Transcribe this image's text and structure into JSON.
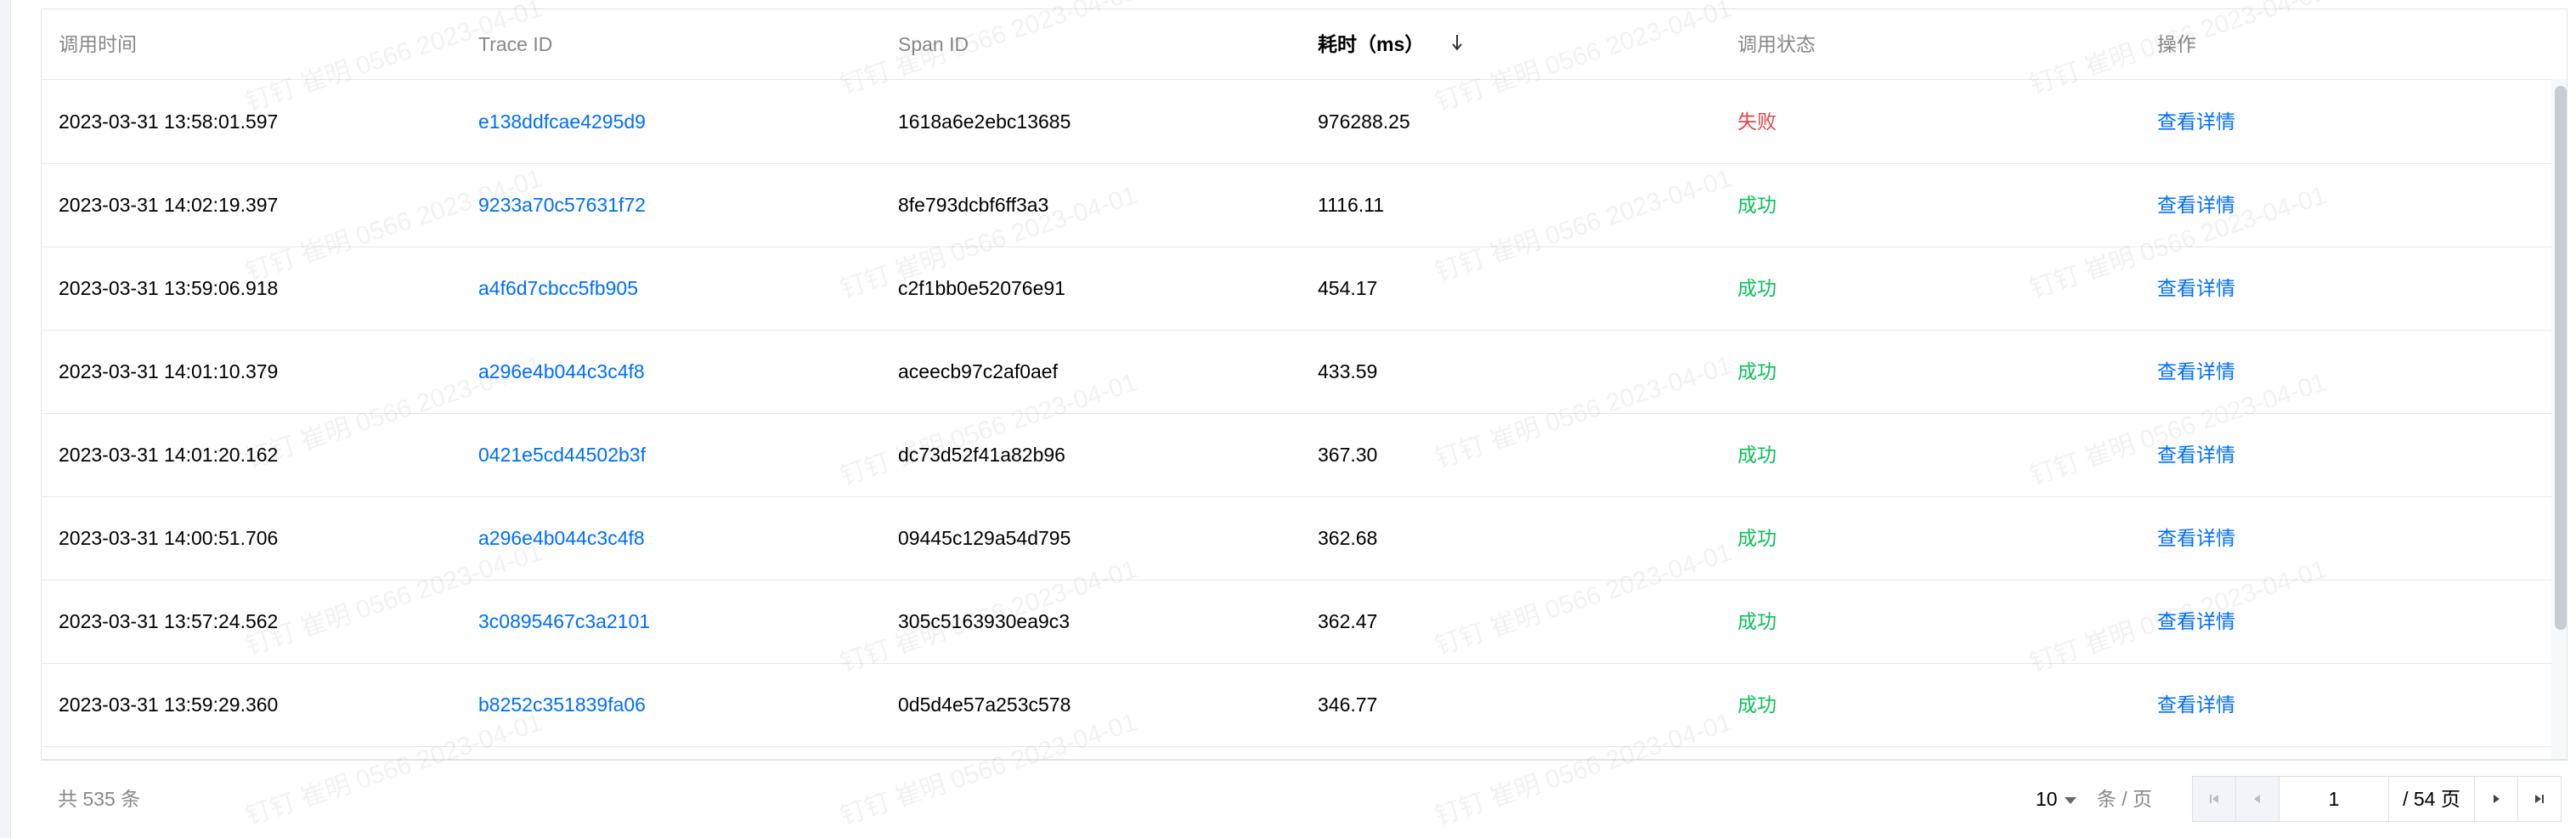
{
  "table": {
    "columns": [
      {
        "label": "调用时间"
      },
      {
        "label": "Trace ID"
      },
      {
        "label": "Span ID"
      },
      {
        "label": "耗时（ms）"
      },
      {
        "label": "调用状态"
      },
      {
        "label": "操作"
      }
    ],
    "rows": [
      {
        "time": "2023-03-31 13:58:01.597",
        "trace_id": "e138ddfcae4295d9",
        "span_id": "1618a6e2ebc13685",
        "duration": "976288.25",
        "status": "失败",
        "status_type": "fail",
        "action": "查看详情"
      },
      {
        "time": "2023-03-31 14:02:19.397",
        "trace_id": "9233a70c57631f72",
        "span_id": "8fe793dcbf6ff3a3",
        "duration": "1116.11",
        "status": "成功",
        "status_type": "ok",
        "action": "查看详情"
      },
      {
        "time": "2023-03-31 13:59:06.918",
        "trace_id": "a4f6d7cbcc5fb905",
        "span_id": "c2f1bb0e52076e91",
        "duration": "454.17",
        "status": "成功",
        "status_type": "ok",
        "action": "查看详情"
      },
      {
        "time": "2023-03-31 14:01:10.379",
        "trace_id": "a296e4b044c3c4f8",
        "span_id": "aceecb97c2af0aef",
        "duration": "433.59",
        "status": "成功",
        "status_type": "ok",
        "action": "查看详情"
      },
      {
        "time": "2023-03-31 14:01:20.162",
        "trace_id": "0421e5cd44502b3f",
        "span_id": "dc73d52f41a82b96",
        "duration": "367.30",
        "status": "成功",
        "status_type": "ok",
        "action": "查看详情"
      },
      {
        "time": "2023-03-31 14:00:51.706",
        "trace_id": "a296e4b044c3c4f8",
        "span_id": "09445c129a54d795",
        "duration": "362.68",
        "status": "成功",
        "status_type": "ok",
        "action": "查看详情"
      },
      {
        "time": "2023-03-31 13:57:24.562",
        "trace_id": "3c0895467c3a2101",
        "span_id": "305c5163930ea9c3",
        "duration": "362.47",
        "status": "成功",
        "status_type": "ok",
        "action": "查看详情"
      },
      {
        "time": "2023-03-31 13:59:29.360",
        "trace_id": "b8252c351839fa06",
        "span_id": "0d5d4e57a253c578",
        "duration": "346.77",
        "status": "成功",
        "status_type": "ok",
        "action": "查看详情"
      }
    ]
  },
  "footer": {
    "total_text": "共  535  条",
    "page_size": "10",
    "per_page_label": "条 / 页",
    "current_page": "1",
    "total_pages": "/ 54 页"
  },
  "watermark": {
    "text": "钉钉 崔明 0566 2023-04-01"
  },
  "colors": {
    "link": "#006eff",
    "success": "#0abf5b",
    "fail": "#e54545",
    "header_text": "#888888"
  },
  "icons": {
    "sort": "sort-down-icon",
    "first": "first-page-icon",
    "prev": "prev-page-icon",
    "next": "next-page-icon",
    "last": "last-page-icon",
    "dropdown": "chevron-down-icon"
  }
}
